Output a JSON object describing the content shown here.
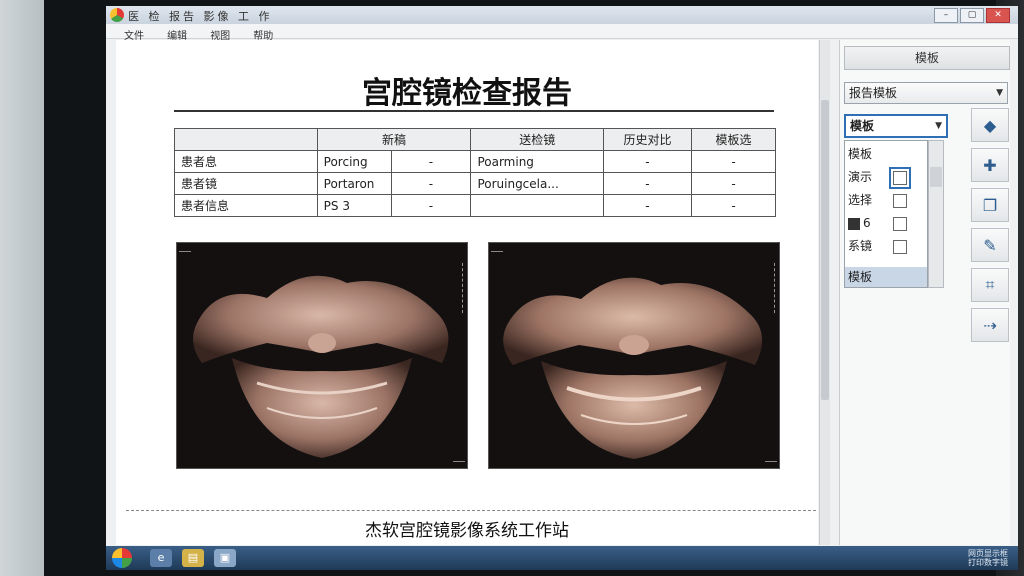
{
  "window": {
    "title": "医 检 报告 影像 工 作",
    "menu": [
      "文件",
      "编辑",
      "视图",
      "帮助"
    ]
  },
  "document": {
    "title": "宫腔镜检查报告",
    "table": {
      "headers": [
        "",
        "新稿",
        "送检镜",
        "历史对比",
        "模板选"
      ],
      "rows": [
        [
          "患者息",
          "Porcing",
          "-",
          "Poarming",
          "-",
          "-"
        ],
        [
          "患者镜",
          "Portaron",
          "-",
          "Poruingcela...",
          "-",
          "-"
        ],
        [
          "患者信息",
          "PS 3",
          "-",
          "",
          "-",
          "-"
        ]
      ]
    },
    "footer": "杰软宫腔镜影像系统工作站"
  },
  "panel": {
    "header": "模板",
    "type_dropdown": "报告模板",
    "template_dropdown": "模板",
    "list": {
      "items": [
        {
          "label": "模板",
          "checkbox": false
        },
        {
          "label": "演示",
          "checkbox": true
        },
        {
          "label": "选择",
          "checkbox": true
        },
        {
          "label": "6",
          "checkbox": true
        },
        {
          "label": "系镜",
          "checkbox": true
        }
      ],
      "selected": "模板"
    },
    "tools": [
      "diamond-icon",
      "plus-icon",
      "copy-icon",
      "pin-icon",
      "crop-icon",
      "arrow-right-icon"
    ]
  },
  "taskbar": {
    "tray_line1": "网页显示框",
    "tray_line2": "打印数字镜"
  }
}
